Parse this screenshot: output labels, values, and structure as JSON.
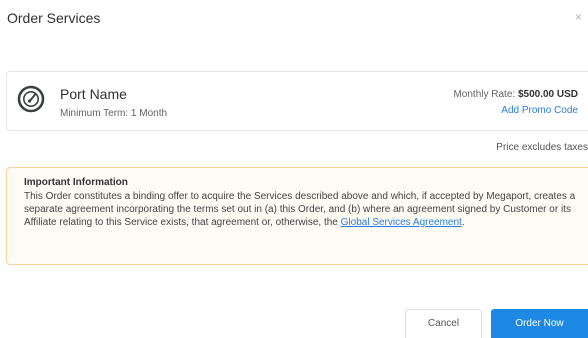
{
  "dialog": {
    "title": "Order Services",
    "close_label": "×"
  },
  "service": {
    "icon": "speedometer-icon",
    "name": "Port Name",
    "term": "Minimum Term: 1 Month",
    "rate_label": "Monthly Rate: ",
    "rate_value": "$500.00 USD",
    "promo_link": "Add Promo Code"
  },
  "tax_note": "Price excludes taxes",
  "info": {
    "heading": "Important Information",
    "text_before_link": "This Order constitutes a binding offer to acquire the Services described above and which, if accepted by Megaport, creates a separate agreement incorporating the terms set out in (a) this Order, and (b) where an agreement signed by Customer or its Affiliate relating to this Service exists, that agreement or, otherwise, the ",
    "link_text": "Global Services Agreement",
    "text_after_link": "."
  },
  "actions": {
    "cancel_label": "Cancel",
    "order_label": "Order Now"
  },
  "colors": {
    "primary": "#1e88e5",
    "link": "#2a7de1",
    "warning_border": "#f5d49a",
    "warning_background": "#fefbf4"
  }
}
